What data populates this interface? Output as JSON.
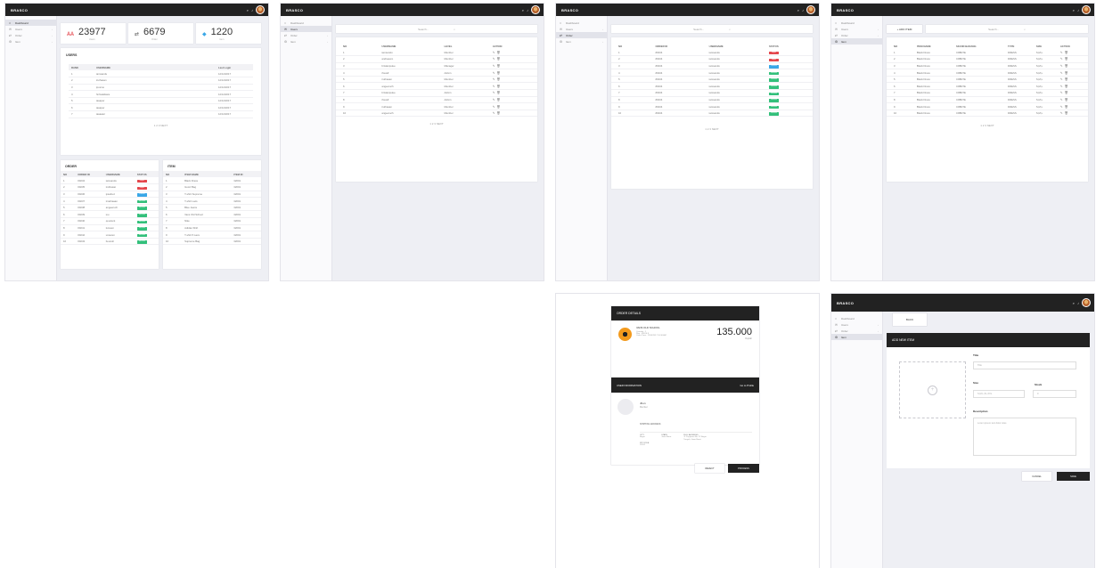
{
  "app": {
    "brand": "BRASCO",
    "search_icon": "search-icon",
    "notify_icon": "bell-icon"
  },
  "sidebar": {
    "items": [
      {
        "icon": "⌂",
        "label": "Dashboard"
      },
      {
        "icon": "✉",
        "label": "Users"
      },
      {
        "icon": "⇄",
        "label": "Order"
      },
      {
        "icon": "⚙",
        "label": "Item"
      }
    ]
  },
  "dashboard": {
    "stats": [
      {
        "icon": "ѦѦ",
        "value": "23977",
        "label": "Users",
        "color": "#e4464c"
      },
      {
        "icon": "⇄",
        "value": "6679",
        "label": "Order",
        "color": "#555555"
      },
      {
        "icon": "◆",
        "value": "1220",
        "label": "Item",
        "color": "#3aa7e7"
      }
    ],
    "users_title": "USERS",
    "users_headers": [
      "RANK",
      "USERNAME",
      "",
      "Last Login"
    ],
    "users_rows": [
      [
        "1",
        "iamsandu",
        "12/12/2017"
      ],
      [
        "2",
        "iruthasan",
        "12/12/2017"
      ],
      [
        "3",
        "iposmo",
        "12/12/2017"
      ],
      [
        "4",
        "hnhsakikara",
        "12/12/2017"
      ],
      [
        "5",
        "iaaaper",
        "12/12/2017"
      ],
      [
        "6",
        "iaaaper",
        "12/12/2017"
      ],
      [
        "7",
        "iaaaaier",
        "12/12/2017"
      ]
    ],
    "users_pager": "1 2 3 NEXT",
    "order_title": "ORDER",
    "order_headers": [
      "NO",
      "ORDER ID",
      "USERNAME",
      "STATUS"
    ],
    "order_rows": [
      [
        "1",
        "#0234",
        "iamsandu",
        "danger"
      ],
      [
        "2",
        "#0235",
        "iruthasan",
        "danger"
      ],
      [
        "3",
        "#0236",
        "ipsafred",
        "info"
      ],
      [
        "4",
        "#0237",
        "irnathaaan",
        "success"
      ],
      [
        "5",
        "#0238",
        "angeeruch",
        "success"
      ],
      [
        "6",
        "#0239",
        "iou",
        "success"
      ],
      [
        "7",
        "#0240",
        "qoucient",
        "success"
      ],
      [
        "8",
        "#0241",
        "lumaun",
        "success"
      ],
      [
        "9",
        "#0242",
        "unsaren",
        "success"
      ],
      [
        "10",
        "#0243",
        "bounoh",
        "success"
      ]
    ],
    "status_text": {
      "danger": "Reject",
      "info": "Process",
      "success": "Success"
    },
    "item_title": "ITEM",
    "item_headers": [
      "NO",
      "ITEM NAME",
      "ITEM ID"
    ],
    "item_rows": [
      [
        "1",
        "Black Dress",
        "32001"
      ],
      [
        "2",
        "Gucci Bag",
        "32001"
      ],
      [
        "3",
        "T-shirt Supreme",
        "32001"
      ],
      [
        "4",
        "T-shirt Lacs",
        "32001"
      ],
      [
        "5",
        "Blue Jeans",
        "32001"
      ],
      [
        "6",
        "Vans Old School",
        "32001"
      ],
      [
        "7",
        "Nike",
        "32001"
      ],
      [
        "8",
        "Adidas Shirt",
        "32001"
      ],
      [
        "9",
        "T-shirt 5 Lacs",
        "32001"
      ],
      [
        "10",
        "Supreme Bag",
        "32001"
      ]
    ]
  },
  "users_page": {
    "search_placeholder": "Search...",
    "headers": [
      "NO",
      "USERNAME",
      "LEVEL",
      "ACTION"
    ],
    "rows": [
      [
        "1",
        "iamsandu",
        "Member"
      ],
      [
        "2",
        "andreaoro",
        "Member"
      ],
      [
        "3",
        "bristanpulee",
        "Manager"
      ],
      [
        "4",
        "ihsusif",
        "Admin"
      ],
      [
        "5",
        "iruthasan",
        "Member"
      ],
      [
        "6",
        "angeeruch",
        "Member"
      ],
      [
        "7",
        "bristanpulee",
        "Admin"
      ],
      [
        "8",
        "ihsusif",
        "Admin"
      ],
      [
        "9",
        "iruthasan",
        "Member"
      ],
      [
        "10",
        "angeeruch",
        "Member"
      ]
    ],
    "pager": "1 2 3 NEXT"
  },
  "orders_page": {
    "search_placeholder": "Search...",
    "headers": [
      "NO",
      "ORDER ID",
      "USERNAME",
      "STATUS"
    ],
    "rows": [
      [
        "1",
        "#0234",
        "iamsandu",
        "danger"
      ],
      [
        "2",
        "#0234",
        "iamsandu",
        "danger"
      ],
      [
        "3",
        "#0234",
        "iamsandu",
        "info"
      ],
      [
        "4",
        "#0234",
        "iamsandu",
        "success"
      ],
      [
        "5",
        "#0234",
        "iamsandu",
        "success"
      ],
      [
        "6",
        "#0234",
        "iamsandu",
        "success"
      ],
      [
        "7",
        "#0234",
        "iamsandu",
        "success"
      ],
      [
        "8",
        "#0234",
        "iamsandu",
        "success"
      ],
      [
        "9",
        "#0234",
        "iamsandu",
        "success"
      ],
      [
        "10",
        "#0234",
        "iamsandu",
        "success"
      ]
    ],
    "pager": "1 2 3 NEXT"
  },
  "items_page": {
    "add_button": "+ ADD ITEM",
    "search_placeholder": "Search...",
    "headers": [
      "NO",
      "ITEM NAME",
      "SKU/ID BARANG",
      "TYPE",
      "SIZE",
      "ACTION"
    ],
    "rows": [
      [
        "1",
        "Black Dress",
        "C9BD7E",
        "DRESS",
        "S,M,L"
      ],
      [
        "2",
        "Black Dress",
        "C9BD7E",
        "DRESS",
        "S,M,L"
      ],
      [
        "3",
        "Black Dress",
        "C9BD7E",
        "DRESS",
        "S,M,L"
      ],
      [
        "4",
        "Black Dress",
        "C9BD7E",
        "DRESS",
        "S,M,L"
      ],
      [
        "5",
        "Black Dress",
        "C9BD7E",
        "DRESS",
        "S,M,L"
      ],
      [
        "6",
        "Black Dress",
        "C9BD7E",
        "DRESS",
        "S,M,L"
      ],
      [
        "7",
        "Black Dress",
        "C9BD7E",
        "DRESS",
        "S,M,L"
      ],
      [
        "8",
        "Black Dress",
        "C9BD7E",
        "DRESS",
        "S,M,L"
      ],
      [
        "9",
        "Black Dress",
        "C9BD7E",
        "DRESS",
        "S,M,L"
      ],
      [
        "10",
        "Black Dress",
        "C9BD7E",
        "DRESS",
        "S,M,L"
      ]
    ],
    "pager": "1 2 3 NEXT"
  },
  "order_detail": {
    "title": "ORDER DETAILS",
    "product_name": "VANS OLD SCHOOL",
    "product_lines": [
      "Quantity : 1",
      "Size : 40/US 8",
      "Order Time : 12/06/2017 10:30 AM"
    ],
    "price": "135.000",
    "currency": "Rupiah",
    "user_info_title": "USER INFORMATION",
    "profile_link": "Go to Profile",
    "user_name": "Jhon",
    "user_level": "Member",
    "shipping_title": "SHIPPING ADDRESS",
    "city_label": "CITY",
    "city_value": "Bogor",
    "state_label": "STATE",
    "state_value": "Jawa Barat",
    "zip_label": "ZIP CODE",
    "zip_value": "16151",
    "address_label": "FULL ADDRESS",
    "address_value": "Jl. Pajajaran No. 12 Bogor Tengah, Jawa Barat",
    "reject_button": "REJECT",
    "process_button": "PROCESS"
  },
  "add_item_page": {
    "back_button": "BACK",
    "title": "ADD NEW ITEM",
    "title_label": "Title",
    "title_placeholder": "Title",
    "size_label": "Size",
    "size_placeholder": "S,M,L,XL,XXL",
    "stock_label": "Stock",
    "stock_placeholder": "0",
    "description_label": "Description",
    "description_placeholder": "Lorem ipsum text dolor sites",
    "cancel_button": "CANCEL",
    "save_button": "SAVE"
  }
}
